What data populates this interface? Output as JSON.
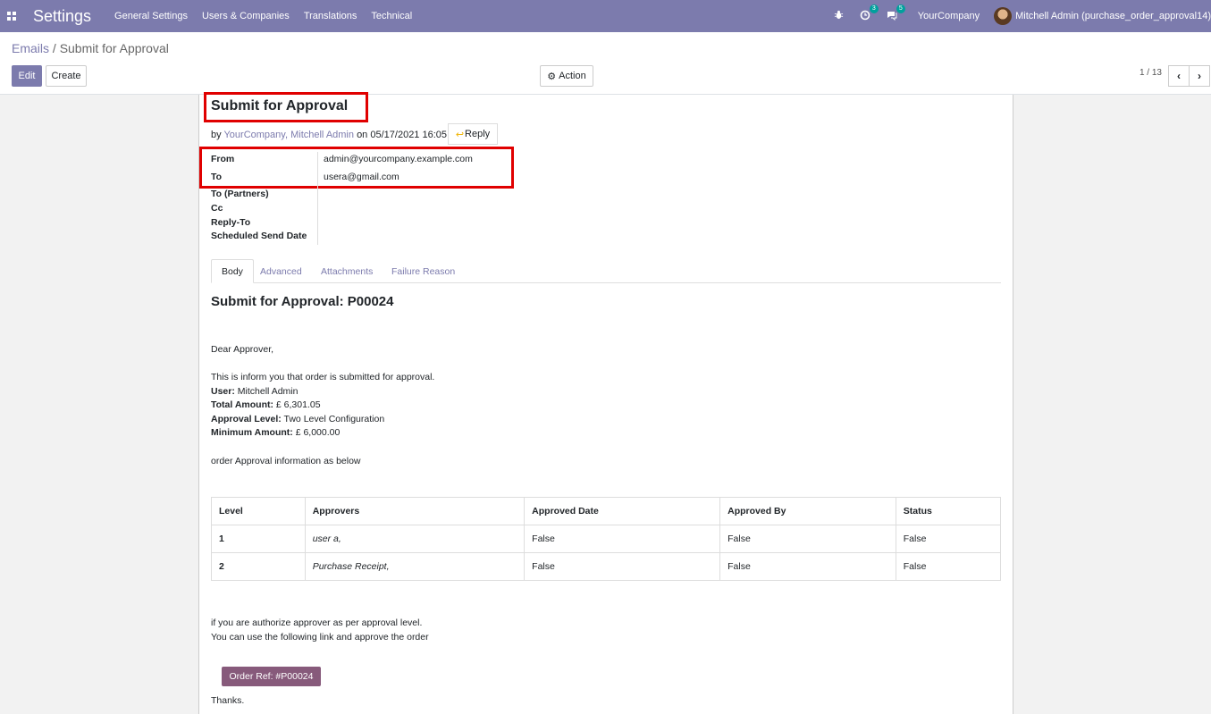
{
  "navbar": {
    "app_name": "Settings",
    "menu": [
      "General Settings",
      "Users & Companies",
      "Translations",
      "Technical"
    ],
    "activity_count": "3",
    "message_count": "5",
    "company": "YourCompany",
    "user": "Mitchell Admin (purchase_order_approval14)"
  },
  "breadcrumb": {
    "parent": "Emails",
    "separator": "/",
    "current": "Submit for Approval"
  },
  "toolbar": {
    "edit_label": "Edit",
    "create_label": "Create",
    "action_label": "Action",
    "pager": "1 / 13"
  },
  "email": {
    "subject": "Submit for Approval",
    "by_prefix": "by",
    "author": "YourCompany, Mitchell Admin",
    "date_prefix": "on",
    "date": "05/17/2021 16:05:26",
    "reply_label": "Reply",
    "fields": {
      "from_label": "From",
      "from_value": "admin@yourcompany.example.com",
      "to_label": "To",
      "to_value": "usera@gmail.com",
      "to_partners_label": "To (Partners)",
      "cc_label": "Cc",
      "reply_to_label": "Reply-To",
      "scheduled_label": "Scheduled Send Date"
    }
  },
  "tabs": [
    "Body",
    "Advanced",
    "Attachments",
    "Failure Reason"
  ],
  "body": {
    "title": "Submit for Approval: P00024",
    "greeting": "Dear Approver,",
    "intro": "This is inform you that order is submitted for approval.",
    "user_label": "User:",
    "user_value": "Mitchell Admin",
    "total_label": "Total Amount:",
    "total_value": "£ 6,301.05",
    "level_label": "Approval Level:",
    "level_value": "Two Level Configuration",
    "min_label": "Minimum Amount:",
    "min_value": "£ 6,000.00",
    "info_line": "order Approval information as below",
    "table": {
      "headers": [
        "Level",
        "Approvers",
        "Approved Date",
        "Approved By",
        "Status"
      ],
      "rows": [
        [
          "1",
          "user a,",
          "False",
          "False",
          "False"
        ],
        [
          "2",
          "Purchase Receipt,",
          "False",
          "False",
          "False"
        ]
      ]
    },
    "authorize_line": "if you are authorize approver as per approval level.",
    "link_line": "You can use the following link and approve the order",
    "order_button": "Order Ref: #P00024",
    "thanks": "Thanks."
  }
}
